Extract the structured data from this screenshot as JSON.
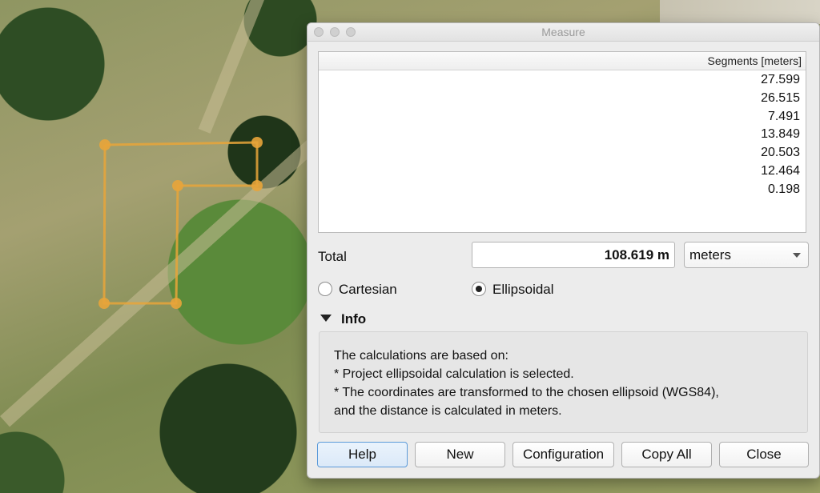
{
  "window": {
    "title": "Measure"
  },
  "segments_table": {
    "header": "Segments [meters]",
    "rows": [
      "27.599",
      "26.515",
      "7.491",
      "13.849",
      "20.503",
      "12.464",
      "0.198"
    ]
  },
  "total": {
    "label": "Total",
    "value": "108.619 m",
    "units_selected": "meters"
  },
  "mode": {
    "cartesian_label": "Cartesian",
    "ellipsoidal_label": "Ellipsoidal",
    "selected": "Ellipsoidal"
  },
  "info": {
    "header": "Info",
    "expanded": true,
    "lines": [
      "The calculations are based on:",
      "* Project ellipsoidal calculation is selected.",
      "* The coordinates are transformed to the chosen ellipsoid (WGS84),",
      "and the distance is calculated in meters."
    ]
  },
  "buttons": {
    "help": "Help",
    "new": "New",
    "configuration": "Configuration",
    "copy_all": "Copy All",
    "close": "Close"
  },
  "colors": {
    "measure_line": "#e8a43a",
    "default_button_border": "#5b9ad9"
  },
  "icons": {
    "info_toggle": "triangle-down",
    "units_dropdown": "chevron-down"
  }
}
